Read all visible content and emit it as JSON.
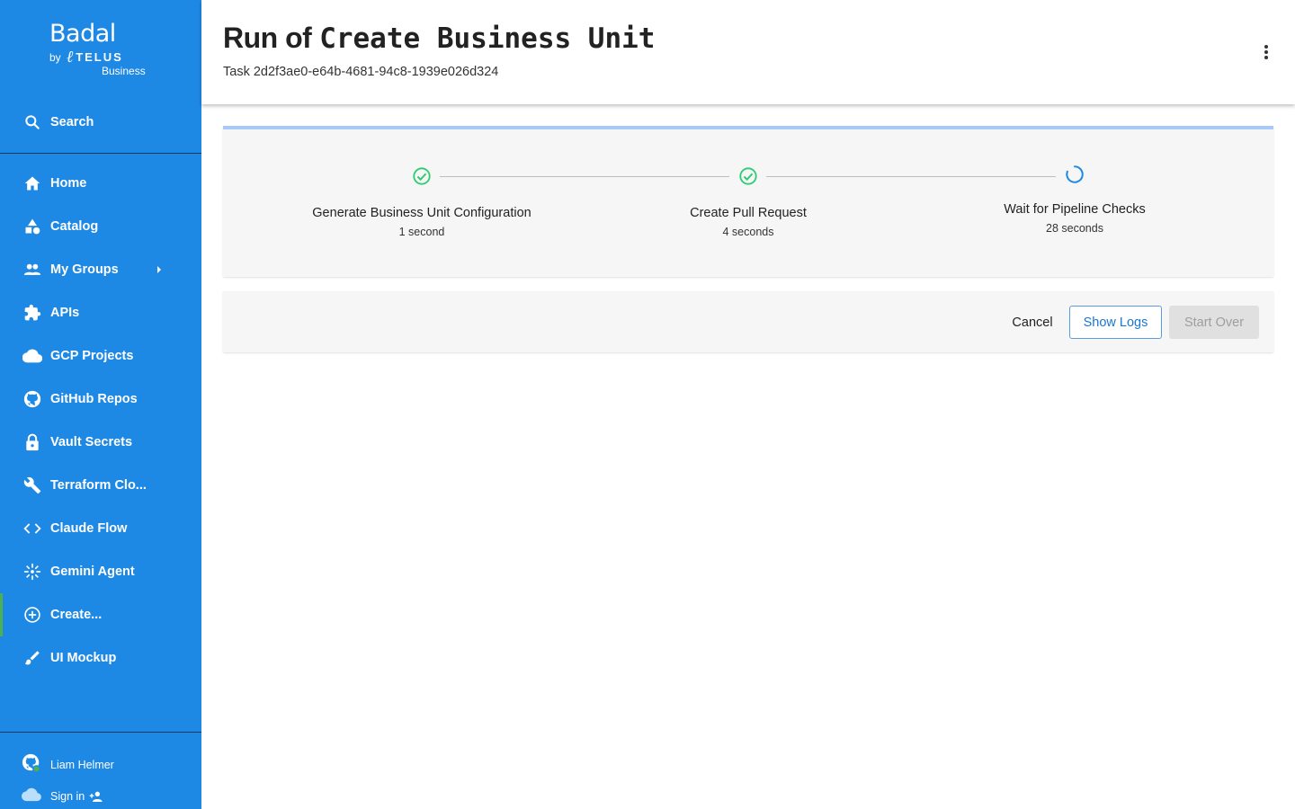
{
  "brand": {
    "name": "Badal",
    "by": "by",
    "company": "TELUS",
    "division": "Business"
  },
  "sidebar": {
    "search_label": "Search",
    "items": [
      {
        "label": "Home",
        "icon": "home-icon"
      },
      {
        "label": "Catalog",
        "icon": "shapes-icon"
      },
      {
        "label": "My Groups",
        "icon": "group-icon"
      },
      {
        "label": "APIs",
        "icon": "puzzle-icon"
      },
      {
        "label": "GCP Projects",
        "icon": "cloud-icon"
      },
      {
        "label": "GitHub Repos",
        "icon": "github-icon"
      },
      {
        "label": "Vault Secrets",
        "icon": "lock-icon"
      },
      {
        "label": "Terraform Clo...",
        "icon": "wrench-icon"
      },
      {
        "label": "Claude Flow",
        "icon": "code-icon"
      },
      {
        "label": "Gemini Agent",
        "icon": "sparkle-icon"
      },
      {
        "label": "Create...",
        "icon": "add-circle-icon"
      },
      {
        "label": "UI Mockup",
        "icon": "brush-icon"
      }
    ],
    "active_item": "Create...",
    "user_name": "Liam Helmer",
    "sign_in_label": "Sign in"
  },
  "header": {
    "title_prefix": "Run of",
    "title_template": "Create Business Unit",
    "task_label": "Task 2d2f3ae0-e64b-4681-94c8-1939e026d324"
  },
  "stepper": {
    "progress": 1.0,
    "steps": [
      {
        "title": "Generate Business Unit Configuration",
        "time": "1 second",
        "status": "completed"
      },
      {
        "title": "Create Pull Request",
        "time": "4 seconds",
        "status": "completed"
      },
      {
        "title": "Wait for Pipeline Checks",
        "time": "28 seconds",
        "status": "in-progress"
      }
    ]
  },
  "actions": {
    "cancel_label": "Cancel",
    "show_logs_label": "Show Logs",
    "start_over_label": "Start Over"
  },
  "colors": {
    "sidebar_bg": "#1e88e5",
    "active_indicator": "#4caf50",
    "success": "#2ecc71",
    "accent": "#1976d2"
  }
}
